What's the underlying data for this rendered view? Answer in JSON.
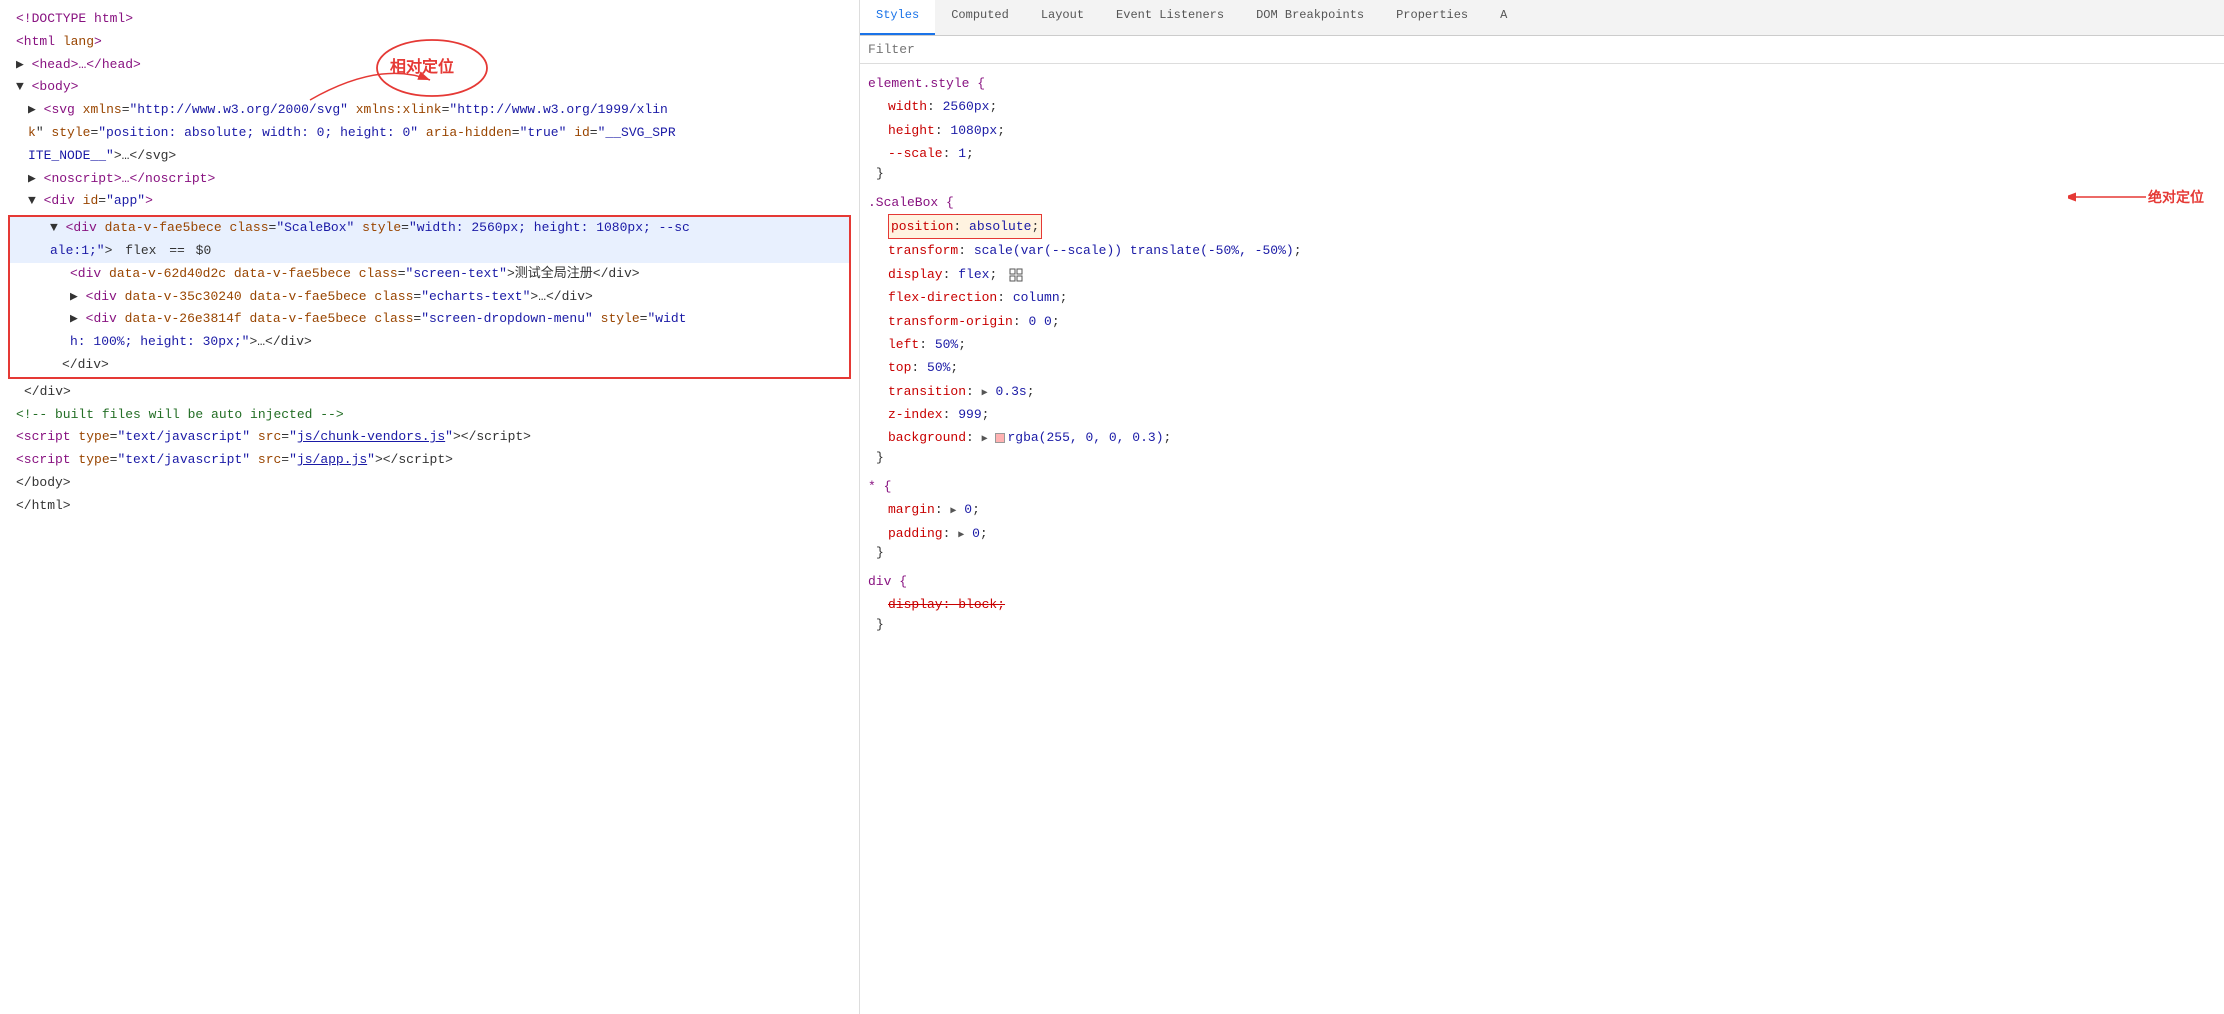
{
  "tabs": {
    "items": [
      {
        "label": "Styles",
        "active": true
      },
      {
        "label": "Computed",
        "active": false
      },
      {
        "label": "Layout",
        "active": false
      },
      {
        "label": "Event Listeners",
        "active": false
      },
      {
        "label": "DOM Breakpoints",
        "active": false
      },
      {
        "label": "Properties",
        "active": false
      },
      {
        "label": "A",
        "active": false
      }
    ]
  },
  "filter": {
    "placeholder": "Filter",
    "label": "Filter"
  },
  "dom": {
    "lines": [
      {
        "text": "<!DOCTYPE html>",
        "type": "normal"
      },
      {
        "text": "<html lang>",
        "type": "normal"
      },
      {
        "text": "▶ <head>…</head>",
        "type": "normal"
      },
      {
        "text": "▼ <body>",
        "type": "normal"
      },
      {
        "text": "  ▶ <svg xmlns=\"http://www.w3.org/2000/svg\" xmlns:xlink=\"http://www.w3.org/1999/xlin",
        "type": "normal"
      },
      {
        "text": "  k\" style=\"position: absolute; width: 0; height: 0\" aria-hidden=\"true\" id=\"__SVG_SPR",
        "type": "normal"
      },
      {
        "text": "  ITE_NODE__\">…</svg>",
        "type": "normal"
      },
      {
        "text": "  ▶ <noscript>…</noscript>",
        "type": "normal"
      },
      {
        "text": "  ▼ <div id=\"app\">",
        "type": "normal"
      }
    ],
    "annotation_relative": "相对定位",
    "annotation_absolute": "绝对定位",
    "highlighted_lines": [
      {
        "text": "  ▼ <div data-v-fae5bece class=\"ScaleBox\" style=\"width: 2560px; height: 1080px; --sc",
        "type": "highlighted-main"
      },
      {
        "text": "  ale:1;\">  flex  == $0",
        "type": "highlighted-main"
      },
      {
        "text": "      <div data-v-62d40d2c data-v-fae5bece class=\"screen-text\">测试全局注册</div>",
        "type": "highlighted-inner"
      },
      {
        "text": "    ▶ <div data-v-35c30240 data-v-fae5bece class=\"echarts-text\">…</div>",
        "type": "highlighted-inner"
      },
      {
        "text": "    ▶ <div data-v-26e3814f data-v-fae5bece class=\"screen-dropdown-menu\" style=\"widt",
        "type": "highlighted-inner"
      },
      {
        "text": "    h: 100%; height: 30px;\">…</div>",
        "type": "highlighted-inner"
      },
      {
        "text": "    </div>",
        "type": "highlighted-inner"
      }
    ],
    "bottom_lines": [
      {
        "text": "  </div>"
      },
      {
        "text": "  <!-- built files will be auto injected -->"
      },
      {
        "text": "  <script type=\"text/javascript\" src=\"js/chunk-vendors.js\"></script>"
      },
      {
        "text": "  <script type=\"text/javascript\" src=\"js/app.js\"></script>"
      },
      {
        "text": "</body>"
      },
      {
        "text": "</html>"
      }
    ]
  },
  "styles": {
    "rules": [
      {
        "selector": "element.style {",
        "properties": [
          {
            "name": "width",
            "value": "2560px;"
          },
          {
            "name": "height",
            "value": "1080px;"
          },
          {
            "name": "--scale",
            "value": "1;"
          }
        ],
        "close": "}"
      },
      {
        "selector": ".ScaleBox {",
        "properties": [
          {
            "name": "position",
            "value": "absolute;",
            "highlighted": true
          },
          {
            "name": "transform",
            "value": "scale(var(--scale)) translate(-50%, -50%);"
          },
          {
            "name": "display",
            "value": "flex;",
            "hasIcon": "grid"
          },
          {
            "name": "flex-direction",
            "value": "column;"
          },
          {
            "name": "transform-origin",
            "value": "0 0;"
          },
          {
            "name": "left",
            "value": "50%;"
          },
          {
            "name": "top",
            "value": "50%;"
          },
          {
            "name": "transition",
            "value": "▶ 0.3s;"
          },
          {
            "name": "z-index",
            "value": "999;"
          },
          {
            "name": "background",
            "value": "▶",
            "hasColor": true,
            "colorValue": "rgba(255, 0, 0, 0.3);"
          }
        ],
        "close": "}"
      },
      {
        "selector": "* {",
        "properties": [
          {
            "name": "margin",
            "value": "▶ 0;"
          },
          {
            "name": "padding",
            "value": "▶ 0;"
          }
        ],
        "close": "}"
      },
      {
        "selector": "div {",
        "properties": [
          {
            "name": "display",
            "value": "block;",
            "strikethrough": true
          }
        ],
        "close": "}"
      }
    ]
  }
}
